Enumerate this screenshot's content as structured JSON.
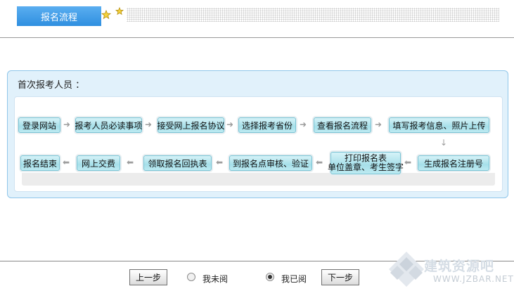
{
  "header": {
    "tab_label": "报名流程"
  },
  "panel": {
    "title": "首次报考人员 ："
  },
  "steps": {
    "s1": "登录网站",
    "s2": "报考人员必读事项",
    "s3": "接受网上报名协议",
    "s4": "选择报考省份",
    "s5": "查看报名流程",
    "s6": "填写报考信息、照片上传",
    "s7": "生成报名注册号",
    "s8_line1": "打印报名表",
    "s8_line2": "单位盖章、考生签字",
    "s9": "到报名点审核、验证",
    "s10": "领取报名回执表",
    "s11": "网上交费",
    "s12": "报名结束"
  },
  "nav": {
    "prev_label": "上一步",
    "unread_label": "我未阅",
    "read_label": "我已阅",
    "next_label": "下一步",
    "selected": "read"
  },
  "watermark": {
    "text": "建筑资源吧",
    "url": "WWW.JZBAR.NET"
  },
  "colors": {
    "tab": "#3b97e3",
    "panel_border": "#8fc6ea",
    "step": "#a6dfe9"
  }
}
